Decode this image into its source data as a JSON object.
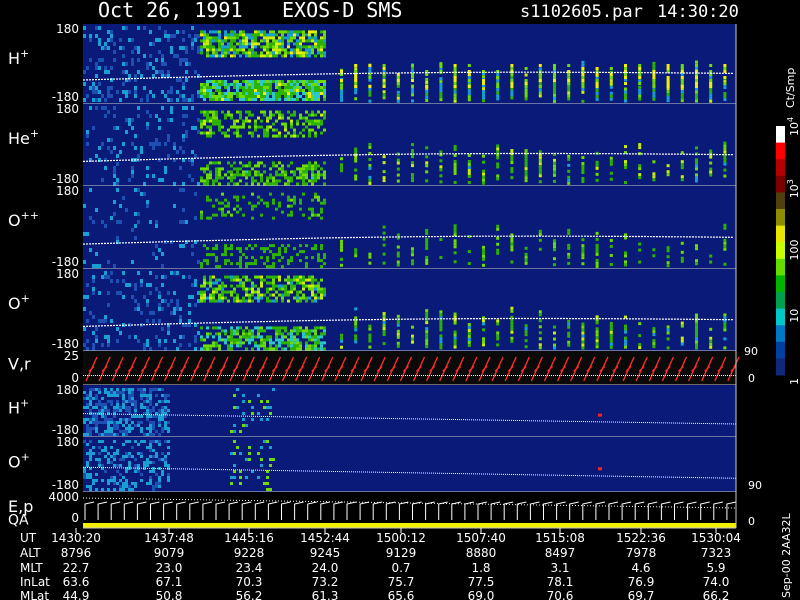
{
  "header": {
    "date": "Oct 26, 1991",
    "instrument": "EXOS-D SMS",
    "file": "s1102605.par",
    "time": "14:30:20"
  },
  "panels": [
    {
      "label": "H",
      "sup": "+",
      "ytop": "180",
      "ybot": "-180"
    },
    {
      "label": "He",
      "sup": "+",
      "ytop": "180",
      "ybot": "-180"
    },
    {
      "label": "O",
      "sup": "++",
      "ytop": "180",
      "ybot": "-180"
    },
    {
      "label": "O",
      "sup": "+",
      "ytop": "180",
      "ybot": "-180"
    },
    {
      "label": "V,r",
      "sup": "",
      "ytop": "25",
      "ybot": "0",
      "rtop": "90",
      "rbot": "0"
    },
    {
      "label": "H",
      "sup": "+",
      "ytop": "180",
      "ybot": "-180"
    },
    {
      "label": "O",
      "sup": "+",
      "ytop": "180",
      "ybot": "-180",
      "rbot": "90"
    },
    {
      "label": "E,p",
      "sup": "",
      "label2": "QA",
      "ytop": "4000",
      "ybot": "0",
      "rbot": "0"
    }
  ],
  "colorbar": {
    "unit": "Ct/Smp",
    "ticks": [
      {
        "base": "10",
        "exp": "4",
        "frac": 1.0
      },
      {
        "base": "10",
        "exp": "3",
        "frac": 0.75
      },
      {
        "base": "100",
        "exp": "",
        "frac": 0.5
      },
      {
        "base": "10",
        "exp": "",
        "frac": 0.25
      },
      {
        "base": "1",
        "exp": "",
        "frac": 0.0
      }
    ],
    "colors": [
      "#ffffff",
      "#ff0000",
      "#b40000",
      "#7a0000",
      "#504010",
      "#8c8c00",
      "#e6e600",
      "#c8ff00",
      "#64dc00",
      "#00b400",
      "#00a050",
      "#00c8c8",
      "#0078c8",
      "#0040a0",
      "#102878"
    ]
  },
  "footer": {
    "row_labels": [
      "UT",
      "ALT",
      "MLT",
      "InLat",
      "MLat"
    ],
    "columns": [
      [
        "1430:20",
        "8796",
        "22.7",
        "63.6",
        "44.9"
      ],
      [
        "1437:48",
        "9079",
        "23.0",
        "67.1",
        "50.8"
      ],
      [
        "1445:16",
        "9228",
        "23.4",
        "70.3",
        "56.2"
      ],
      [
        "1452:44",
        "9245",
        "24.0",
        "73.2",
        "61.3"
      ],
      [
        "1500:12",
        "9129",
        "0.7",
        "75.7",
        "65.6"
      ],
      [
        "1507:40",
        "8880",
        "1.8",
        "77.5",
        "69.0"
      ],
      [
        "1515:08",
        "8497",
        "3.1",
        "78.1",
        "70.6"
      ],
      [
        "1522:36",
        "7978",
        "4.6",
        "76.9",
        "69.7"
      ],
      [
        "1530:04",
        "7323",
        "5.9",
        "74.0",
        "66.2"
      ]
    ],
    "side_label": "Sep-00  2AA32L"
  },
  "chart_data": {
    "type": "heatmap",
    "title": "Oct 26, 1991   EXOS-D SMS",
    "x": [
      "1430:20",
      "1437:48",
      "1445:16",
      "1452:44",
      "1500:12",
      "1507:40",
      "1515:08",
      "1522:36",
      "1530:04"
    ],
    "ylim": [
      -180,
      180
    ],
    "colorbar_range": [
      1,
      10000
    ],
    "colorbar_scale": "log",
    "series": [
      {
        "name": "H+"
      },
      {
        "name": "He+"
      },
      {
        "name": "O++"
      },
      {
        "name": "O+"
      },
      {
        "name": "V,r"
      },
      {
        "name": "H+"
      },
      {
        "name": "O+"
      },
      {
        "name": "E,p"
      }
    ]
  }
}
